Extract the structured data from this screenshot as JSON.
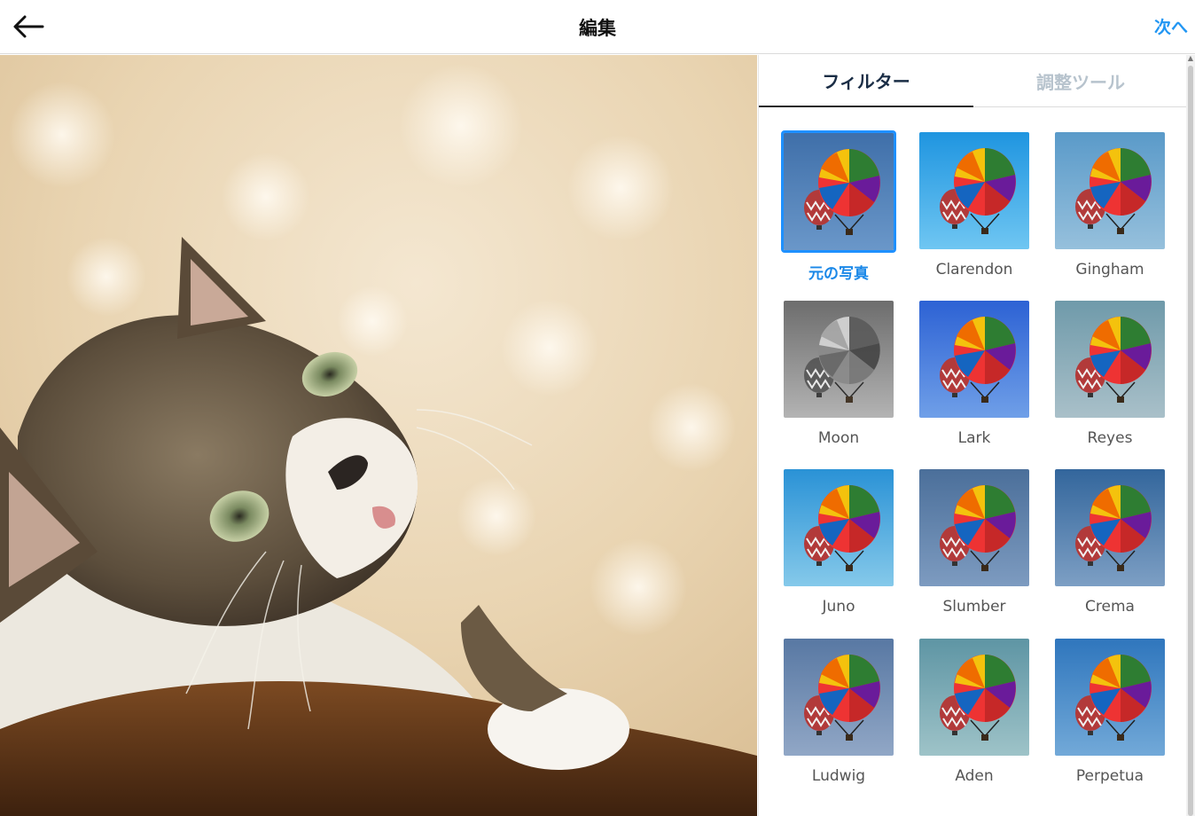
{
  "header": {
    "title": "編集",
    "next_label": "次へ"
  },
  "tabs": [
    {
      "label": "フィルター",
      "active": true
    },
    {
      "label": "調整ツール",
      "active": false
    }
  ],
  "filters": [
    {
      "name": "元の写真",
      "selected": true,
      "bg1": "#3f6fa9",
      "bg2": "#6a97c9"
    },
    {
      "name": "Clarendon",
      "selected": false,
      "bg1": "#1f95e0",
      "bg2": "#6fc6f2"
    },
    {
      "name": "Gingham",
      "selected": false,
      "bg1": "#5a9ac9",
      "bg2": "#96c0dc"
    },
    {
      "name": "Moon",
      "selected": false,
      "bg1": "#6d6d6d",
      "bg2": "#b3b3b3"
    },
    {
      "name": "Lark",
      "selected": false,
      "bg1": "#2d62d4",
      "bg2": "#6f9fe8"
    },
    {
      "name": "Reyes",
      "selected": false,
      "bg1": "#6f9aaa",
      "bg2": "#a9c0c9"
    },
    {
      "name": "Juno",
      "selected": false,
      "bg1": "#2a92d6",
      "bg2": "#85c9ea"
    },
    {
      "name": "Slumber",
      "selected": false,
      "bg1": "#4b6f9a",
      "bg2": "#7d9bc0"
    },
    {
      "name": "Crema",
      "selected": false,
      "bg1": "#33669c",
      "bg2": "#7d9fc4"
    },
    {
      "name": "Ludwig",
      "selected": false,
      "bg1": "#5878a3",
      "bg2": "#91a7c6"
    },
    {
      "name": "Aden",
      "selected": false,
      "bg1": "#5e95a4",
      "bg2": "#9ec3c8"
    },
    {
      "name": "Perpetua",
      "selected": false,
      "bg1": "#2f76bd",
      "bg2": "#72a9d8"
    }
  ]
}
